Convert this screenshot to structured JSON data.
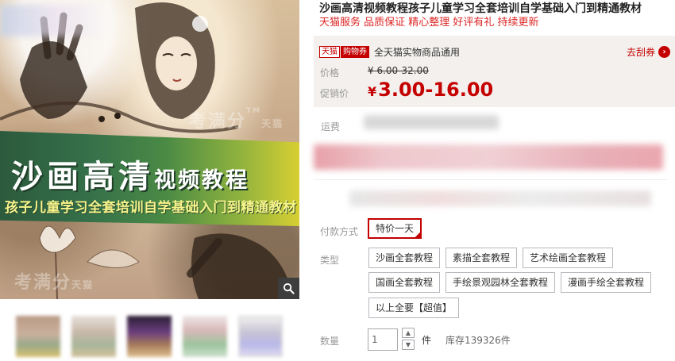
{
  "product": {
    "title": "沙画高清视频教程孩子儿童学习全套培训自学基础入门到精通教材",
    "subtitle": "天猫服务 品质保证 精心整理 好评有礼 持续更新"
  },
  "gallery": {
    "banner_title_big": "沙画高清",
    "banner_title_small": "视频教程",
    "banner_subtitle": "孩子儿童学习全套培训自学基础入门到精通教材",
    "watermark_top": "考满分",
    "watermark_top_mark": "TM",
    "watermark_top_brand": "天猫",
    "watermark_bottom": "考满分",
    "watermark_bottom_brand": "天猫"
  },
  "coupon": {
    "tmall_tag": "天猫",
    "cart_tag": "购物券",
    "text": "全天猫实物商品通用",
    "action": "去刮券",
    "action_icon": "chevron-right-icon"
  },
  "price": {
    "original_label": "价格",
    "original_currency": "¥",
    "original_value": "6.00-32.00",
    "promo_label": "促销价",
    "promo_currency": "¥",
    "promo_value": "3.00-16.00"
  },
  "shipping": {
    "label": "运费"
  },
  "options": {
    "pay_label": "付款方式",
    "pay_selected": "特价一天",
    "type_label": "类型",
    "types": [
      "沙画全套教程",
      "素描全套教程",
      "艺术绘画全套教程",
      "国画全套教程",
      "手绘景观园林全套教程",
      "漫画手绘全套教程",
      "以上全要【超值】"
    ]
  },
  "quantity": {
    "label": "数量",
    "value": "1",
    "unit": "件",
    "stock": "库存139326件"
  },
  "colors": {
    "brand_red": "#c40000",
    "subtitle_red": "#dd2727",
    "price_box_bg": "#f3f0ed"
  }
}
